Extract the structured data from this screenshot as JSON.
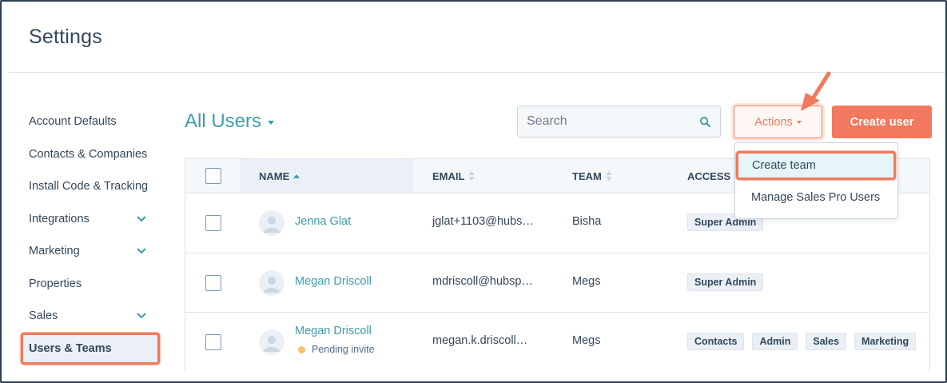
{
  "page": {
    "title": "Settings"
  },
  "sidebar": {
    "items": [
      {
        "label": "Account Defaults",
        "has_chevron": false
      },
      {
        "label": "Contacts & Companies",
        "has_chevron": false
      },
      {
        "label": "Install Code & Tracking",
        "has_chevron": false
      },
      {
        "label": "Integrations",
        "has_chevron": true
      },
      {
        "label": "Marketing",
        "has_chevron": true
      },
      {
        "label": "Properties",
        "has_chevron": false
      },
      {
        "label": "Sales",
        "has_chevron": true
      },
      {
        "label": "Users & Teams",
        "has_chevron": false,
        "active": true
      }
    ]
  },
  "header": {
    "view_label": "All Users",
    "search_placeholder": "Search",
    "actions_label": "Actions",
    "create_user_label": "Create user"
  },
  "actions_menu": {
    "items": [
      "Create team",
      "Manage Sales Pro Users"
    ]
  },
  "table": {
    "columns": {
      "name": "NAME",
      "email": "EMAIL",
      "team": "TEAM",
      "access": "ACCESS"
    },
    "rows": [
      {
        "name": "Jenna Glat",
        "email": "jglat+1103@hubs…",
        "team": "Bisha",
        "access": [
          "Super Admin"
        ]
      },
      {
        "name": "Megan Driscoll",
        "email": "mdriscoll@hubsp…",
        "team": "Megs",
        "access": [
          "Super Admin"
        ]
      },
      {
        "name": "Megan Driscoll",
        "status": "Pending invite",
        "email": "megan.k.driscoll…",
        "team": "Megs",
        "access": [
          "Contacts",
          "Admin",
          "Sales",
          "Marketing"
        ]
      }
    ]
  },
  "colors": {
    "accent": "#f2795d",
    "link": "#3d9cad",
    "text": "#33475b",
    "pending": "#f5c26b"
  }
}
